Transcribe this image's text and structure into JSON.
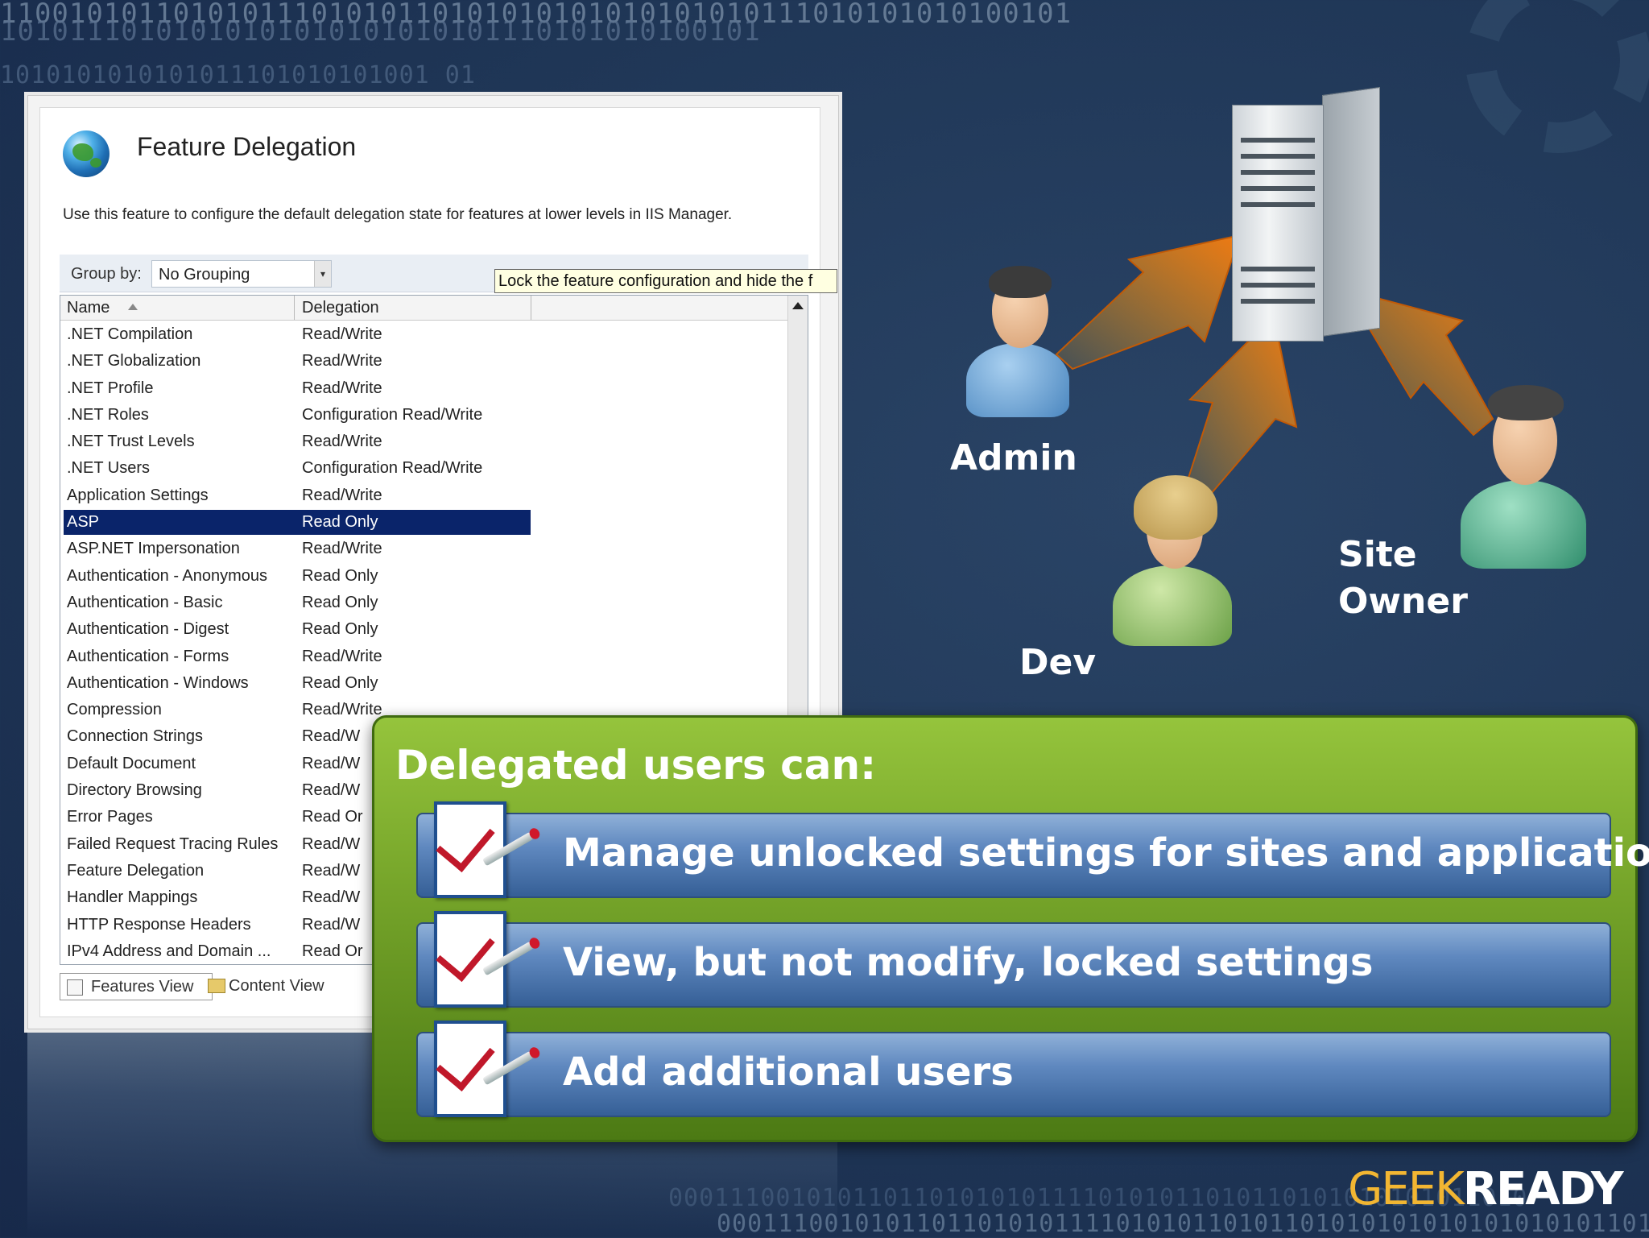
{
  "background": {
    "binary_lines": [
      "11001010110101011101010110101010101010101010111010101010100101",
      "10101110101010101010101010101110101010100101",
      "1010101010101011101010101001 01",
      "00011100101011011010101011110101011010110101010101011010",
      "0001110010101101101010111101010110101101010101010101010101101010"
    ]
  },
  "iis_window": {
    "title": "Feature Delegation",
    "description": "Use this feature to configure the default delegation state for features at lower levels in IIS Manager.",
    "group_by_label": "Group by:",
    "group_by_value": "No Grouping",
    "tooltip": "Lock the feature configuration and hide the f",
    "columns": {
      "name": "Name",
      "delegation": "Delegation"
    },
    "rows": [
      {
        "name": ".NET Compilation",
        "delegation": "Read/Write"
      },
      {
        "name": ".NET Globalization",
        "delegation": "Read/Write"
      },
      {
        "name": ".NET Profile",
        "delegation": "Read/Write"
      },
      {
        "name": ".NET Roles",
        "delegation": "Configuration Read/Write"
      },
      {
        "name": ".NET Trust Levels",
        "delegation": "Read/Write"
      },
      {
        "name": ".NET Users",
        "delegation": "Configuration Read/Write"
      },
      {
        "name": "Application Settings",
        "delegation": "Read/Write"
      },
      {
        "name": "ASP",
        "delegation": "Read Only",
        "selected": true
      },
      {
        "name": "ASP.NET Impersonation",
        "delegation": "Read/Write"
      },
      {
        "name": "Authentication - Anonymous",
        "delegation": "Read Only"
      },
      {
        "name": "Authentication - Basic",
        "delegation": "Read Only"
      },
      {
        "name": "Authentication - Digest",
        "delegation": "Read Only"
      },
      {
        "name": "Authentication - Forms",
        "delegation": "Read/Write"
      },
      {
        "name": "Authentication - Windows",
        "delegation": "Read Only"
      },
      {
        "name": "Compression",
        "delegation": "Read/Write"
      },
      {
        "name": "Connection Strings",
        "delegation": "Read/W"
      },
      {
        "name": "Default Document",
        "delegation": "Read/W"
      },
      {
        "name": "Directory Browsing",
        "delegation": "Read/W"
      },
      {
        "name": "Error Pages",
        "delegation": "Read Or"
      },
      {
        "name": "Failed Request Tracing Rules",
        "delegation": "Read/W"
      },
      {
        "name": "Feature Delegation",
        "delegation": "Read/W"
      },
      {
        "name": "Handler Mappings",
        "delegation": "Read/W"
      },
      {
        "name": "HTTP Response Headers",
        "delegation": "Read/W"
      },
      {
        "name": "IPv4 Address and Domain ...",
        "delegation": "Read Or"
      }
    ],
    "view_tabs": {
      "features": "Features View",
      "content": "Content View"
    }
  },
  "diagram": {
    "labels": {
      "admin": "Admin",
      "dev": "Dev",
      "site_owner_line1": "Site",
      "site_owner_line2": "Owner"
    },
    "arrow_color": "#f07a12"
  },
  "panel": {
    "title": "Delegated users can:",
    "items": [
      "Manage unlocked settings for sites and applications",
      "View, but not modify, locked settings",
      "Add additional users"
    ]
  },
  "logo": {
    "part1": "GEEK",
    "part2": "READY"
  }
}
